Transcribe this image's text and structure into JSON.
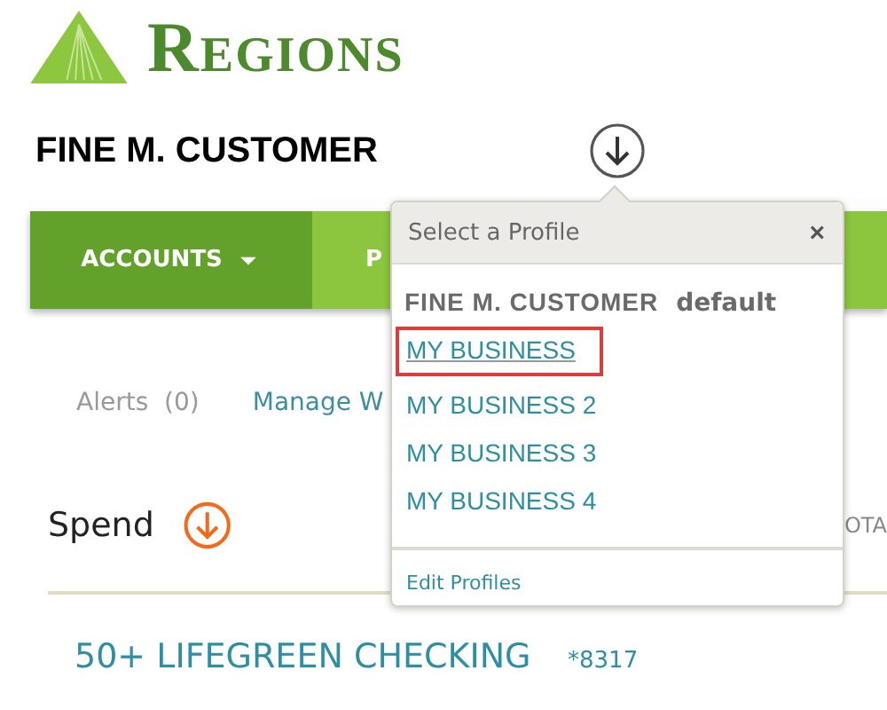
{
  "logo": {
    "text": "Regions"
  },
  "customer_name": "FINE M. CUSTOMER",
  "nav": {
    "tabs": [
      {
        "label": "ACCOUNTS",
        "selected": true,
        "dropdown": true
      },
      {
        "label": "P",
        "selected": false,
        "dropdown": false
      }
    ]
  },
  "links": [
    {
      "label": "Alerts",
      "count": "(0)",
      "kind": "muted"
    },
    {
      "label": "Manage W",
      "kind": "link"
    }
  ],
  "spend": {
    "title": "Spend",
    "column_3": "OTA"
  },
  "account": {
    "name": "50+ LIFEGREEN CHECKING",
    "number": "*8317"
  },
  "profile_menu": {
    "title": "Select a Profile",
    "close": "×",
    "default_profile": {
      "name": "FINE M. CUSTOMER",
      "tag": "default"
    },
    "profiles": [
      {
        "label": "MY BUSINESS",
        "selected": true
      },
      {
        "label": "MY BUSINESS 2",
        "selected": false
      },
      {
        "label": "MY BUSINESS 3",
        "selected": false
      },
      {
        "label": "MY BUSINESS 4",
        "selected": false
      }
    ],
    "footer_link": "Edit Profiles"
  }
}
